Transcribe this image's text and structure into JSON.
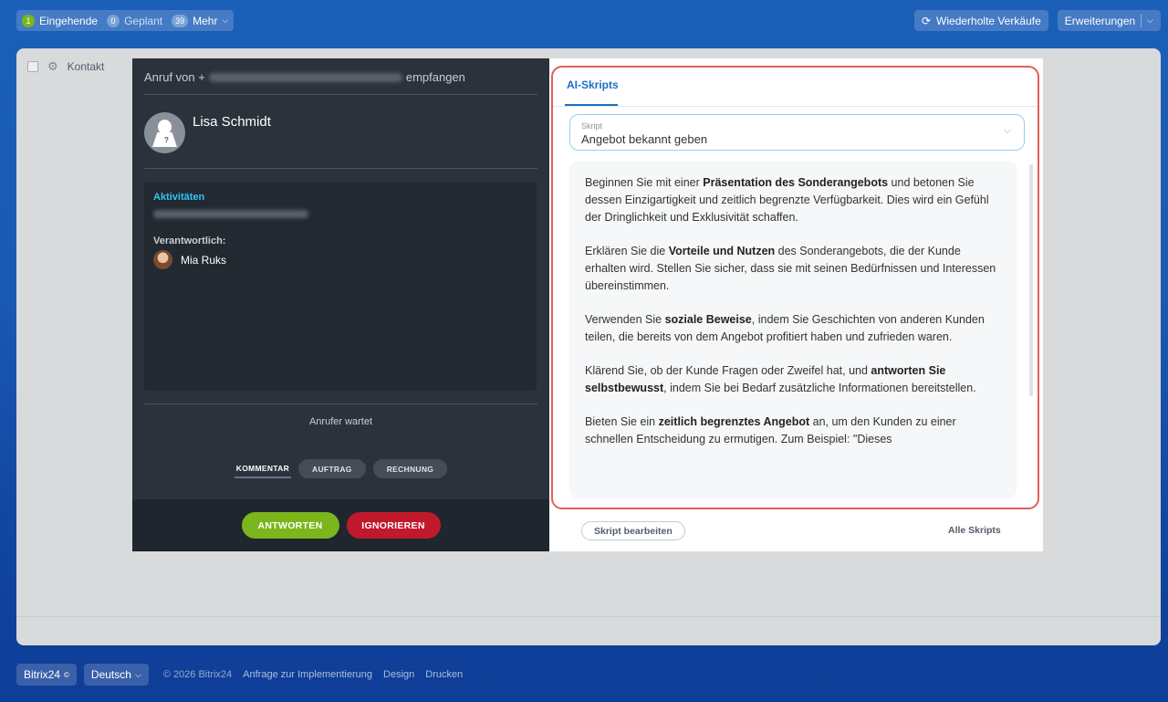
{
  "topbar": {
    "incoming": {
      "count": "1",
      "label": "Eingehende"
    },
    "planned": {
      "count": "0",
      "label": "Geplant"
    },
    "more": {
      "count": "39",
      "label": "Mehr"
    },
    "repeat_sales": "Wiederholte Verkäufe",
    "extensions": "Erweiterungen"
  },
  "main": {
    "header_label": "Kontakt"
  },
  "call": {
    "title_prefix": "Anruf von +",
    "title_suffix": "empfangen",
    "caller_name": "Lisa Schmidt",
    "activities_label": "Aktivitäten",
    "responsible_label": "Verantwortlich:",
    "responsible_name": "Mia Ruks",
    "waiting": "Anrufer wartet",
    "tabs": [
      "KOMMENTAR",
      "AUFTRAG",
      "RECHNUNG"
    ],
    "answer": "ANTWORTEN",
    "ignore": "IGNORIEREN"
  },
  "ai": {
    "tab": "AI-Skripts",
    "select_label": "Skript",
    "select_value": "Angebot bekannt geben",
    "paragraphs": [
      {
        "pre": "Beginnen Sie mit einer ",
        "bold": "Präsentation des Sonderangebots",
        "post": " und betonen Sie dessen Einzigartigkeit und zeitlich begrenzte Verfügbarkeit. Dies wird ein Gefühl der Dringlichkeit und Exklusivität schaffen."
      },
      {
        "pre": "Erklären Sie die ",
        "bold": "Vorteile und Nutzen",
        "post": " des Sonderangebots, die der Kunde erhalten wird. Stellen Sie sicher, dass sie mit seinen Bedürfnissen und Interessen übereinstimmen."
      },
      {
        "pre": "Verwenden Sie ",
        "bold": "soziale Beweise",
        "post": ", indem Sie Geschichten von anderen Kunden teilen, die bereits von dem Angebot profitiert haben und zufrieden waren."
      },
      {
        "pre": "Klärend Sie, ob der Kunde Fragen oder Zweifel hat, und ",
        "bold": "antworten Sie selbstbewusst",
        "post": ", indem Sie bei Bedarf zusätzliche Informationen bereitstellen."
      },
      {
        "pre": "Bieten Sie ein ",
        "bold": "zeitlich begrenztes Angebot",
        "post": " an, um den Kunden zu einer schnellen Entscheidung zu ermutigen. Zum Beispiel: \"Dieses"
      }
    ],
    "edit_button": "Skript bearbeiten",
    "all_scripts": "Alle Skripts"
  },
  "footer": {
    "brand": "Bitrix24",
    "brand_mark": "©",
    "language": "Deutsch",
    "copyright": "© 2026 Bitrix24",
    "links": [
      "Anfrage zur Implementierung",
      "Design",
      "Drucken"
    ]
  },
  "colors": {
    "accent": "#1b6fc9",
    "answer": "#7bb61d",
    "ignore": "#c1192b",
    "highlight": "#e0605a"
  }
}
